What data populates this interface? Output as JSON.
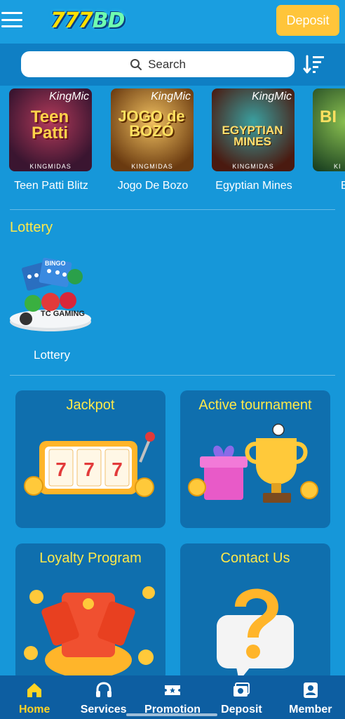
{
  "header": {
    "logo_text_num": "777",
    "logo_text_bd": "BD",
    "deposit_label": "Deposit"
  },
  "search": {
    "placeholder": "Search"
  },
  "games": [
    {
      "name": "Teen Patti Blitz",
      "tag": "KingMic",
      "brand": "KINGMIDAS",
      "art": "Teen Patti"
    },
    {
      "name": "Jogo De Bozo",
      "tag": "KingMic",
      "brand": "KINGMIDAS",
      "art": "JOGO de BOZÓ"
    },
    {
      "name": "Egyptian Mines",
      "tag": "KingMic",
      "brand": "KINGMIDAS",
      "art": "EGYPTIAN MINES"
    },
    {
      "name": "B",
      "tag": "",
      "brand": "KI",
      "art": "BI"
    }
  ],
  "lottery": {
    "section_title": "Lottery",
    "item_name": "Lottery",
    "thumb_text_top": "BINGO",
    "thumb_text_brand": "TC GAMING"
  },
  "cards": [
    {
      "title": "Jackpot"
    },
    {
      "title": "Active tournament"
    },
    {
      "title": "Loyalty Program"
    },
    {
      "title": "Contact Us"
    }
  ],
  "bottom_nav": [
    {
      "label": "Home",
      "icon": "home-icon",
      "active": true
    },
    {
      "label": "Services",
      "icon": "headset-icon",
      "active": false
    },
    {
      "label": "Promotion",
      "icon": "ticket-icon",
      "active": false
    },
    {
      "label": "Deposit",
      "icon": "wallet-icon",
      "active": false
    },
    {
      "label": "Member",
      "icon": "member-icon",
      "active": false
    }
  ],
  "colors": {
    "background": "#1697d9",
    "accent_yellow": "#ffe94a",
    "deposit_button": "#ffc53a",
    "nav_background": "#0d5ea1",
    "nav_active": "#ffd324"
  }
}
